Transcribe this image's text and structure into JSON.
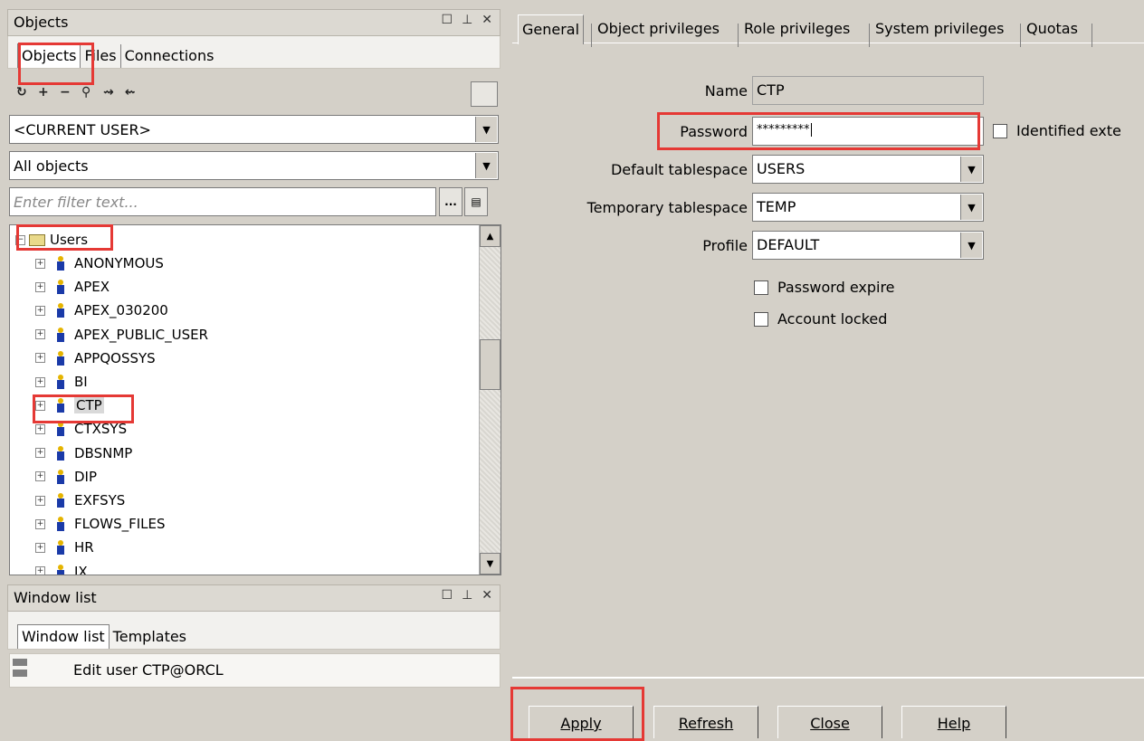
{
  "objects_panel": {
    "title": "Objects",
    "tabs": [
      "Objects",
      "Files",
      "Connections"
    ],
    "user_combo": "<CURRENT USER>",
    "type_combo": "All objects",
    "filter_placeholder": "Enter filter text...",
    "filter_button": "...",
    "tree": {
      "root": "Users",
      "items": [
        "ANONYMOUS",
        "APEX",
        "APEX_030200",
        "APEX_PUBLIC_USER",
        "APPQOSSYS",
        "BI",
        "CTP",
        "CTXSYS",
        "DBSNMP",
        "DIP",
        "EXFSYS",
        "FLOWS_FILES",
        "HR",
        "IX"
      ],
      "selected": "CTP"
    }
  },
  "window_list_panel": {
    "title": "Window list",
    "tabs": [
      "Window list",
      "Templates"
    ],
    "items": [
      "Edit user CTP@ORCL"
    ]
  },
  "editor": {
    "tabs": [
      "General",
      "Object privileges",
      "Role privileges",
      "System privileges",
      "Quotas"
    ],
    "fields": {
      "name_label": "Name",
      "name_value": "CTP",
      "password_label": "Password",
      "password_value": "*********",
      "identified_ext_label": "Identified exte",
      "default_ts_label": "Default tablespace",
      "default_ts_value": "USERS",
      "temp_ts_label": "Temporary tablespace",
      "temp_ts_value": "TEMP",
      "profile_label": "Profile",
      "profile_value": "DEFAULT",
      "password_expire_label": "Password expire",
      "account_locked_label": "Account locked"
    },
    "buttons": [
      "Apply",
      "Refresh",
      "Close",
      "Help"
    ]
  },
  "highlight_color": "#e53935"
}
